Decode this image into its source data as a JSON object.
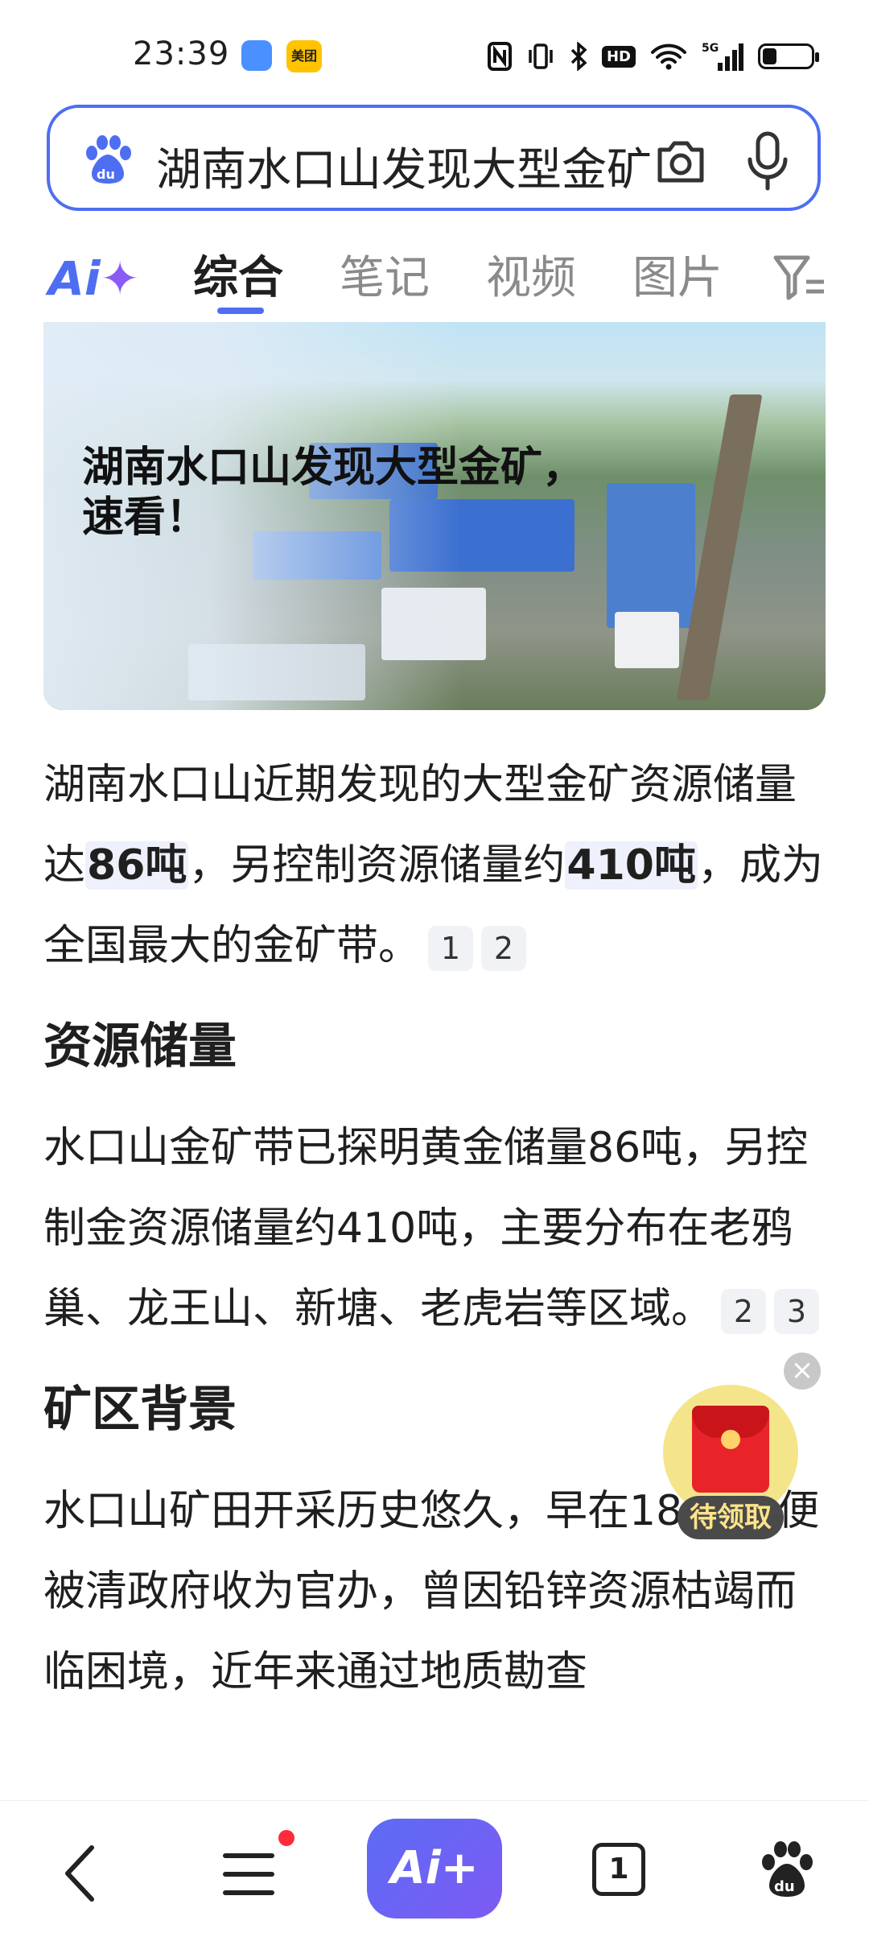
{
  "status_bar": {
    "time": "23:39",
    "app_badge_2": "美团",
    "hd_label": "HD",
    "network": "5G",
    "battery_percent": 30
  },
  "search": {
    "query": "湖南水口山发现大型金矿"
  },
  "tabs": [
    {
      "label": "综合",
      "active": true
    },
    {
      "label": "笔记",
      "active": false
    },
    {
      "label": "视频",
      "active": false
    },
    {
      "label": "图片",
      "active": false
    }
  ],
  "hero": {
    "title_line1": "湖南水口山发现大型金矿，",
    "title_line2": "速看！"
  },
  "summary": {
    "text_a": "湖南水口山近期发现的大型金矿资源储量达",
    "hl1": "86吨",
    "text_b": "，另控制资源储量约",
    "hl2": "410吨",
    "text_c": "，成为全国最大的金矿带。",
    "cites": [
      "1",
      "2"
    ]
  },
  "section1": {
    "heading": "资源储量",
    "text": "水口山金矿带已探明黄金储量86吨，另控制金资源储量约410吨，主要分布在老鸦巢、龙王山、新塘、老虎岩等区域。",
    "cites": [
      "2",
      "3"
    ]
  },
  "section2": {
    "heading": "矿区背景",
    "text": "水口山矿田开采历史悠久，早在1896年便被清政府收为官办，曾因铅锌资源枯竭而临困境，近年来通过地质勘查"
  },
  "red_packet": {
    "label": "待领取",
    "close": "×"
  },
  "bottom_nav": {
    "ai_label": "Ai+",
    "tab_count": "1"
  },
  "colors": {
    "accent": "#4e6ef2",
    "ai_purple": "#8a5cf5",
    "notification": "#ff2a3a",
    "red_packet": "#e8242a"
  },
  "icons": [
    "baidu-paw-icon",
    "camera-icon",
    "microphone-icon",
    "filter-icon",
    "back-icon",
    "menu-icon",
    "tabs-icon",
    "baidu-home-icon"
  ]
}
